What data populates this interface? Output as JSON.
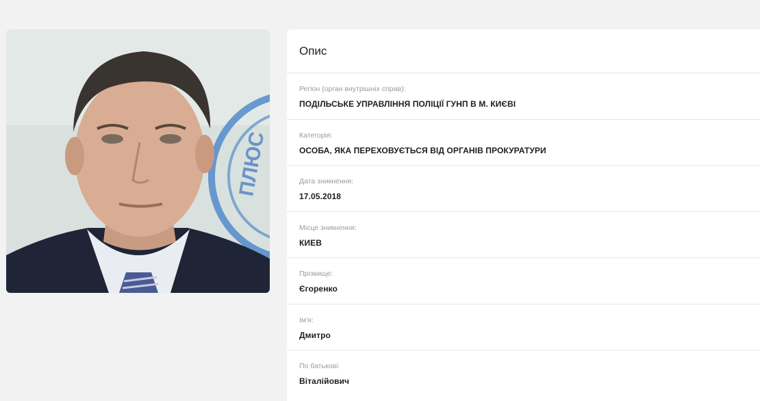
{
  "photo": {
    "alt": "Фото зниклої особи",
    "stamp_text": "ПЛЮС"
  },
  "details": {
    "title": "Опис",
    "fields": [
      {
        "label": "Регіон (орган внутрішніх справ):",
        "value": "ПОДІЛЬСЬКЕ УПРАВЛІННЯ ПОЛІЦІЇ ГУНП В М. КИЄВІ"
      },
      {
        "label": "Категорія:",
        "value": "ОСОБА, ЯКА ПЕРЕХОВУЄТЬСЯ ВІД ОРГАНІВ ПРОКУРАТУРИ"
      },
      {
        "label": "Дата зникнення:",
        "value": "17.05.2018"
      },
      {
        "label": "Місце зникнення:",
        "value": "КИЕВ"
      },
      {
        "label": "Прізвище:",
        "value": "Єгоренко"
      },
      {
        "label": "Ім'я:",
        "value": "Дмитро"
      },
      {
        "label": "По батькові:",
        "value": "Віталійович"
      }
    ]
  },
  "colors": {
    "page_background": "#f2f2f2",
    "card_background": "#ffffff",
    "label_text": "#9a9a9a",
    "value_text": "#1e1e1e"
  }
}
